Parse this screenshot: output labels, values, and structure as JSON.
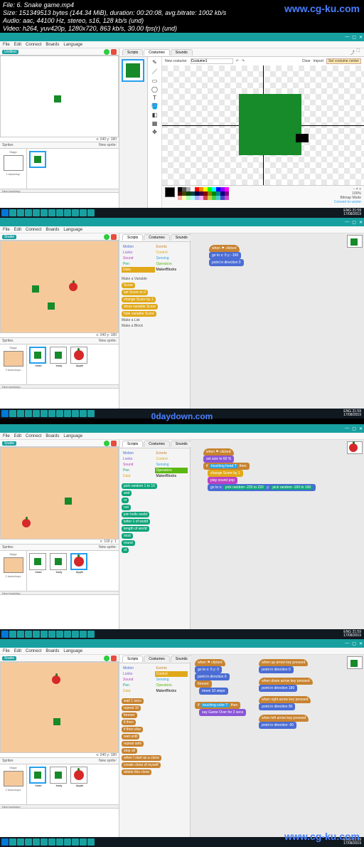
{
  "meta_overlay": {
    "line1": "File: 6. Snake game.mp4",
    "line2": "Size: 151349513 bytes (144.34 MiB), duration: 00:20:08, avg.bitrate: 1002 kb/s",
    "line3": "Audio: aac, 44100 Hz, stereo, s16, 128 kb/s (und)",
    "line4": "Video: h264, yuv420p, 1280x720, 863 kb/s, 30.00 fps(r) (und)"
  },
  "watermarks": {
    "top": "www.cg-ku.com",
    "mid": "0daydown.com",
    "bottom": "www.cg-ku.com"
  },
  "menu": {
    "file": "File",
    "edit": "Edit",
    "connect": "Connect",
    "boards": "Boards",
    "language": "Language"
  },
  "tabs": {
    "scripts": "Scripts",
    "costumes": "Costumes",
    "sounds": "Sounds"
  },
  "panel1": {
    "costume_label": "New costume:",
    "costume_name": "Costume1",
    "clear": "Clear",
    "import": "Import",
    "tooltip": "Set costume center",
    "zoom": "100%",
    "mode": "Bitmap Mode",
    "convert": "Convert to vector",
    "coords": "x: 240 y: 180",
    "sprites": "Sprites",
    "new_sprite": "New sprite:",
    "stage": "Stage",
    "backdrops": "1 backdrop"
  },
  "panel2": {
    "stage_name": "Snake",
    "coords": "x: 240 y: 180",
    "sprites": "Sprites",
    "new_sprite": "New sprite:",
    "stage": "Stage",
    "backdrops": "2 backdrops",
    "cats": {
      "motion": "Motion",
      "looks": "Looks",
      "sound": "Sound",
      "pen": "Pen",
      "data": "Data",
      "events": "Events",
      "control": "Control",
      "sensing": "Sensing",
      "operators": "Operators",
      "more": "MakerBlocks"
    },
    "make_var": "Make a Variable",
    "make_list": "Make a List",
    "make_block": "Make a Block",
    "blocks": {
      "score": "Score",
      "set": "set Score to 0",
      "change": "change Score by 1",
      "show": "show variable Score",
      "hide": "hide variable Score"
    },
    "script": {
      "hat": "when ⚑ clicked",
      "goto": "go to x: 0 y: -160",
      "dir": "point in direction 0"
    },
    "sprites_list": [
      "head",
      "body",
      "Apple"
    ]
  },
  "panel3": {
    "stage_name": "Snake",
    "coords": "x: 100 y: 1",
    "cats": {
      "motion": "Motion",
      "looks": "Looks",
      "sound": "Sound",
      "pen": "Pen",
      "data": "Data",
      "events": "Events",
      "control": "Control",
      "sensing": "Sensing",
      "operators": "Operators",
      "more": "MakerBlocks"
    },
    "palette": [
      "pick random 1 to 10",
      "and",
      "or",
      "not",
      "join hello world",
      "letter 1 of world",
      "length of world",
      "mod",
      "round",
      "of"
    ],
    "script": {
      "hat": "when ⚑ clicked",
      "setsize": "set size to 60 %",
      "if": "if",
      "cond": "touching head ?",
      "then": "then",
      "change": "change Score by 1",
      "sound": "play sound pop",
      "goto": "go to x:",
      "rand1": "pick random -220 to 220",
      "rand2": "pick random -160 to 160"
    },
    "sprites_list": [
      "head",
      "body",
      "Apple"
    ]
  },
  "panel4": {
    "stage_name": "Snake",
    "cats": {
      "motion": "Motion",
      "looks": "Looks",
      "sound": "Sound",
      "pen": "Pen",
      "data": "Data",
      "events": "Events",
      "control": "Control",
      "sensing": "Sensing",
      "operators": "Operators",
      "more": "MakerBlocks"
    },
    "palette": [
      "wait 1 secs",
      "repeat 10",
      "forever",
      "if then",
      "if then else",
      "wait until",
      "repeat until",
      "stop all",
      "when I start as a clone",
      "create clone of myself",
      "delete this clone"
    ],
    "scriptA": {
      "hat": "when ⚑ clicked",
      "goto": "go to x: 0 y: 0",
      "dir": "point in direction 0",
      "forever": "forever",
      "move": "move 10 steps",
      "if": "if",
      "cond": "touching color ?",
      "then": "then",
      "say": "say Game Over for 2 secs"
    },
    "scriptB": [
      {
        "hat": "when up arrow key pressed",
        "body": "point in direction 0"
      },
      {
        "hat": "when down arrow key pressed",
        "body": "point in direction 180"
      },
      {
        "hat": "when right arrow key pressed",
        "body": "point in direction 90"
      },
      {
        "hat": "when left arrow key pressed",
        "body": "point in direction -90"
      }
    ],
    "sprites_list": [
      "head",
      "body",
      "Apple"
    ]
  },
  "taskbar": {
    "clock": "21:59",
    "date": "17/08/2019",
    "lang": "ENG"
  }
}
